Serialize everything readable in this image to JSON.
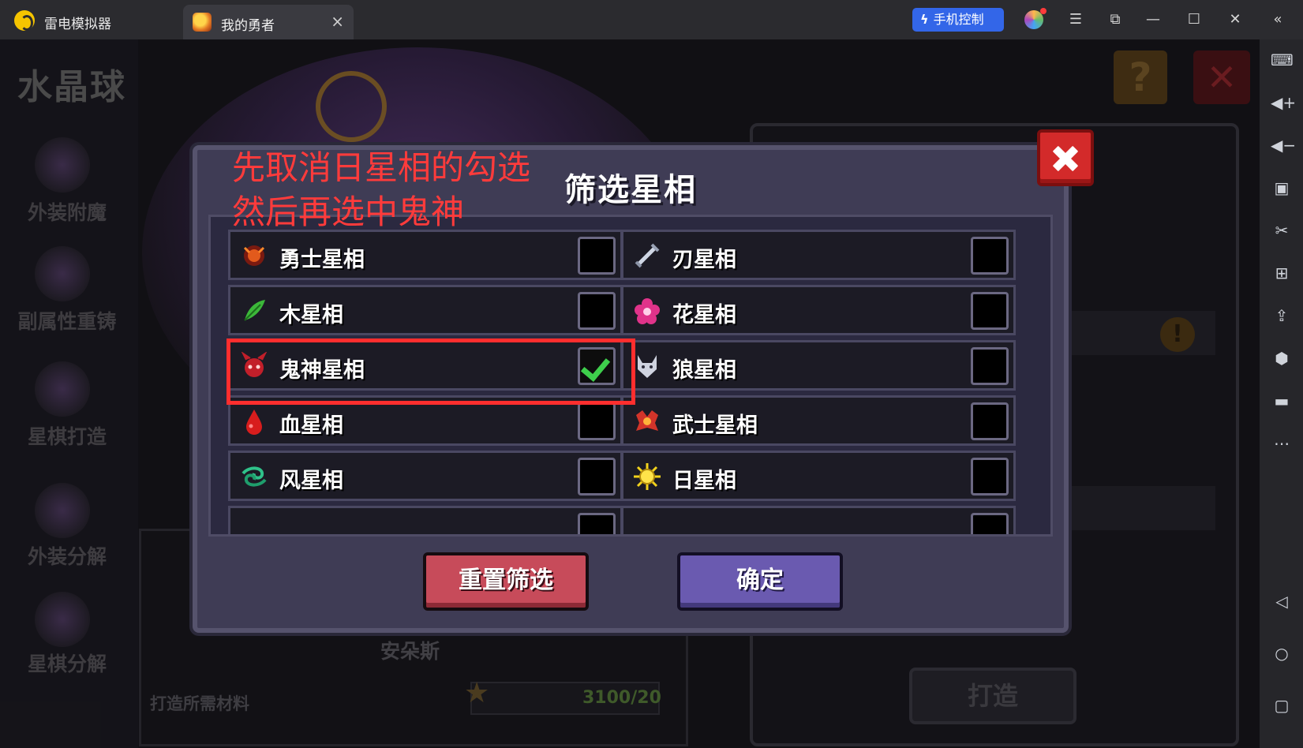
{
  "emulator": {
    "app_name": "雷电模拟器",
    "tab_title": "我的勇者",
    "tab_close": "×",
    "phone_control_label": "手机控制",
    "window_buttons": [
      "☰",
      "⧉",
      "—",
      "☐",
      "✕",
      "«"
    ],
    "toolbar_icons": [
      "keyboard-icon",
      "volume-up-icon",
      "volume-down-icon",
      "screenshot-icon",
      "scissors-icon",
      "add-window-icon",
      "apk-install-icon",
      "settings-icon",
      "folder-icon",
      "more-icon",
      "back-icon",
      "home-icon",
      "recents-icon"
    ]
  },
  "game": {
    "page_title": "水晶球",
    "sidebar": [
      {
        "label": "外装附魔"
      },
      {
        "label": "副属性重铸"
      },
      {
        "label": "星棋打造"
      },
      {
        "label": "外装分解"
      },
      {
        "label": "星棋分解"
      }
    ],
    "help_label": "?",
    "close_label": "✕",
    "alert_label": "!",
    "hero_name": "安朵斯",
    "materials_label": "打造所需材料",
    "materials_count": "3100/20",
    "forge_button": "打造"
  },
  "dialog": {
    "title": "筛选星相",
    "options": [
      {
        "label": "勇士星相",
        "icon": "warrior-icon",
        "checked": false
      },
      {
        "label": "刃星相",
        "icon": "blade-icon",
        "checked": false
      },
      {
        "label": "木星相",
        "icon": "wood-icon",
        "checked": false
      },
      {
        "label": "花星相",
        "icon": "flower-icon",
        "checked": false
      },
      {
        "label": "鬼神星相",
        "icon": "demon-icon",
        "checked": true
      },
      {
        "label": "狼星相",
        "icon": "wolf-icon",
        "checked": false
      },
      {
        "label": "血星相",
        "icon": "blood-icon",
        "checked": false
      },
      {
        "label": "武士星相",
        "icon": "samurai-icon",
        "checked": false
      },
      {
        "label": "风星相",
        "icon": "wind-icon",
        "checked": false
      },
      {
        "label": "日星相",
        "icon": "sun-icon",
        "checked": false
      }
    ],
    "reset_button": "重置筛选",
    "confirm_button": "确定"
  },
  "annotation": {
    "line1": "先取消日星相的勾选",
    "line2": "然后再选中鬼神"
  },
  "colors": {
    "accent_blue": "#3366e8",
    "annotation_red": "#ff3b3b",
    "dialog_bg": "#3f3c55",
    "reset_red": "#c74b5a",
    "confirm_purple": "#6a5ab0",
    "check_green": "#3ecf4c"
  }
}
